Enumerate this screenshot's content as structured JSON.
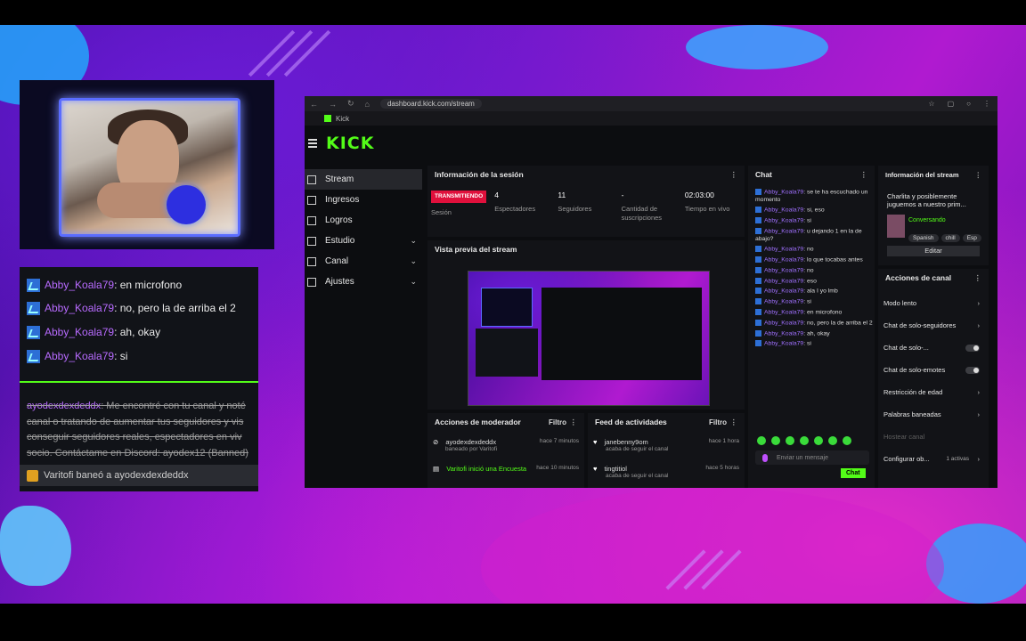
{
  "browser": {
    "url": "dashboard.kick.com/stream",
    "tab_label": "Kick"
  },
  "brand": {
    "logo": "KICK",
    "accent": "#53fc18"
  },
  "overlay_chat": {
    "messages": [
      {
        "user": "Abby_Koala79",
        "text": ": en microfono"
      },
      {
        "user": "Abby_Koala79",
        "text": ": no, pero la de arriba el 2"
      },
      {
        "user": "Abby_Koala79",
        "text": ": ah, okay"
      },
      {
        "user": "Abby_Koala79",
        "text": ": si"
      }
    ],
    "banned_message": {
      "user": "ayodexdexdeddx",
      "text": ": Me encontré con tu canal y noté canal o tratando de aumentar tus seguidores y vis conseguir seguidores reales, espectadores en viv socio. Contáctame en Discord: ayodex12",
      "status": "(Banned)"
    },
    "ban_notice": "Varitofi baneó a ayodexdexdeddx"
  },
  "sidenav": {
    "items": [
      {
        "label": "Stream",
        "active": true,
        "icon": "stream-icon"
      },
      {
        "label": "Ingresos",
        "icon": "revenue-icon"
      },
      {
        "label": "Logros",
        "icon": "trophy-icon"
      },
      {
        "label": "Estudio",
        "icon": "studio-icon",
        "chevron": true
      },
      {
        "label": "Canal",
        "icon": "channel-icon",
        "chevron": true
      },
      {
        "label": "Ajustes",
        "icon": "settings-icon",
        "chevron": true
      }
    ]
  },
  "session": {
    "title": "Información de la sesión",
    "live_label": "TRANSMITIENDO",
    "stats": [
      {
        "value": "",
        "label": "Sesión"
      },
      {
        "value": "4",
        "label": "Espectadores"
      },
      {
        "value": "11",
        "label": "Seguidores"
      },
      {
        "value": "-",
        "label": "Cantidad de suscripciones"
      },
      {
        "value": "02:03:00",
        "label": "Tiempo en vivo"
      }
    ]
  },
  "preview": {
    "title": "Vista previa del stream"
  },
  "mod_actions": {
    "title": "Acciones de moderador",
    "filter": "Filtro",
    "rows": [
      {
        "main": "ayodexdexdeddx",
        "sub": "baneado por Varitofi",
        "time": "hace 7 minutos"
      },
      {
        "main": "Varitofi inició una Encuesta",
        "sub": "",
        "time": "hace 10 minutos"
      }
    ]
  },
  "activity": {
    "title": "Feed de actividades",
    "filter": "Filtro",
    "rows": [
      {
        "main": "janebenny9om",
        "sub": "acaba de seguir el canal",
        "time": "hace 1 hora"
      },
      {
        "main": "tingtitiol",
        "sub": "acaba de seguir el canal",
        "time": "hace 5 horas"
      }
    ]
  },
  "chat": {
    "title": "Chat",
    "messages": [
      {
        "user": "Abby_Koala79",
        "text": ": se te ha escuchado un momento"
      },
      {
        "user": "Abby_Koala79",
        "text": ": si, eso"
      },
      {
        "user": "Abby_Koala79",
        "text": ": si"
      },
      {
        "user": "Abby_Koala79",
        "text": ": u dejando 1 en la de abajo?"
      },
      {
        "user": "Abby_Koala79",
        "text": ": no"
      },
      {
        "user": "Abby_Koala79",
        "text": ": lo que tocabas antes"
      },
      {
        "user": "Abby_Koala79",
        "text": ": no"
      },
      {
        "user": "Abby_Koala79",
        "text": ": eso"
      },
      {
        "user": "Abby_Koala79",
        "text": ": ala I yo lmb"
      },
      {
        "user": "Abby_Koala79",
        "text": ": si"
      },
      {
        "user": "Abby_Koala79",
        "text": ": en microfono"
      },
      {
        "user": "Abby_Koala79",
        "text": ": no, pero la de arriba el 2"
      },
      {
        "user": "Abby_Koala79",
        "text": ": ah, okay"
      },
      {
        "user": "Abby_Koala79",
        "text": ": si"
      }
    ],
    "input_placeholder": "Enviar un mensaje",
    "send_label": "Chat"
  },
  "stream_info": {
    "title": "Información del stream",
    "stream_title": "Charlita y posiblemente juguemos a nuestro prim...",
    "category": "Conversando",
    "tags": [
      "Spanish",
      "chill",
      "Esp"
    ],
    "edit_label": "Editar"
  },
  "channel_actions": {
    "title": "Acciones de canal",
    "rows": [
      {
        "label": "Modo lento",
        "control": "arrow"
      },
      {
        "label": "Chat de solo-seguidores",
        "control": "arrow"
      },
      {
        "label": "Chat de solo-...",
        "control": "toggle"
      },
      {
        "label": "Chat de solo-emotes",
        "control": "toggle"
      },
      {
        "label": "Restricción de edad",
        "control": "arrow"
      },
      {
        "label": "Palabras baneadas",
        "control": "arrow"
      },
      {
        "label": "Hostear canal",
        "control": "none",
        "disabled": true
      },
      {
        "label": "Configurar ob...",
        "control": "arrow",
        "extra": "1 activas"
      }
    ]
  }
}
